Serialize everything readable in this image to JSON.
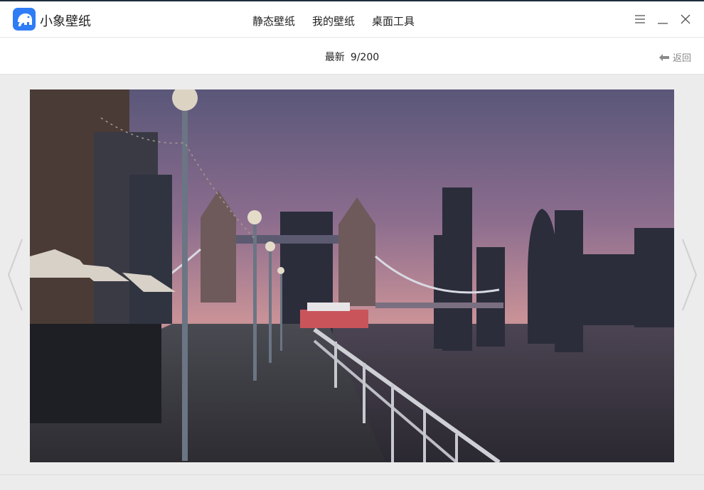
{
  "app": {
    "name": "小象壁纸"
  },
  "nav": {
    "items": [
      "静态壁纸",
      "我的壁纸",
      "桌面工具"
    ]
  },
  "subbar": {
    "category": "最新",
    "position": "9/200",
    "back_label": "返回"
  },
  "colors": {
    "accent": "#2f7df6",
    "titlebar_top": "#1f2d3d",
    "background": "#ececec"
  },
  "icons": [
    "elephant-logo-icon",
    "menu-icon",
    "minimize-icon",
    "close-icon",
    "back-arrow-icon",
    "chevron-left-icon",
    "chevron-right-icon"
  ]
}
